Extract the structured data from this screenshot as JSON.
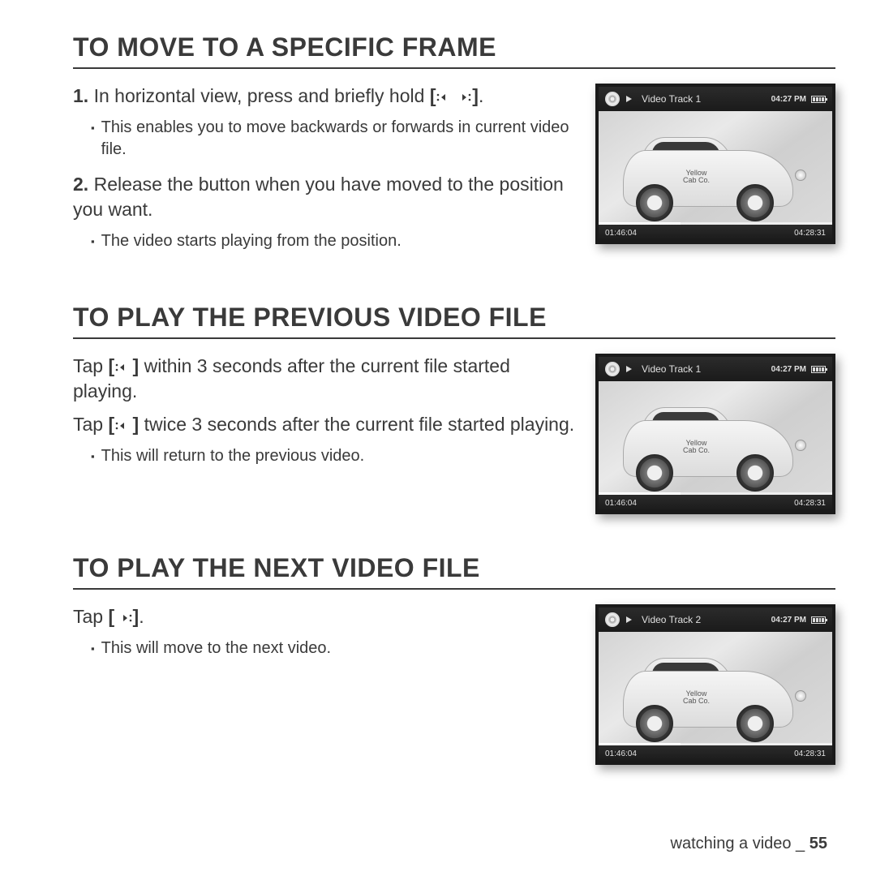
{
  "sections": [
    {
      "heading": "TO MOVE TO A SPECIFIC FRAME",
      "steps": [
        {
          "num": "1.",
          "text_before": "In horizontal view, press and briefly hold ",
          "buttons": "lr",
          "text_after": "."
        },
        {
          "sub": "This enables you to move backwards or forwards in current video file."
        },
        {
          "num": "2.",
          "text_before": "Release the button when you have moved to the position you want.",
          "buttons": "",
          "text_after": ""
        },
        {
          "sub": "The video starts playing from the position."
        }
      ],
      "video": {
        "title": "Video Track 1",
        "clock": "04:27 PM",
        "pos": "01:46:04",
        "dur": "04:28:31"
      }
    },
    {
      "heading": "TO PLAY THE PREVIOUS VIDEO FILE",
      "steps": [
        {
          "text_before": "Tap ",
          "buttons": "l",
          "text_after": " within 3 seconds after the current file started playing."
        },
        {
          "text_before": "Tap ",
          "buttons": "l",
          "text_after": " twice 3 seconds after the current file started playing."
        },
        {
          "sub": "This will return to the previous video."
        }
      ],
      "video": {
        "title": "Video Track 1",
        "clock": "04:27 PM",
        "pos": "01:46:04",
        "dur": "04:28:31"
      }
    },
    {
      "heading": "TO PLAY THE NEXT VIDEO FILE",
      "steps": [
        {
          "text_before": "Tap ",
          "buttons": "r",
          "text_after": "."
        },
        {
          "sub": "This will move to the next video."
        }
      ],
      "video": {
        "title": "Video Track 2",
        "clock": "04:27 PM",
        "pos": "01:46:04",
        "dur": "04:28:31"
      }
    }
  ],
  "footer": {
    "label": "watching a video _ ",
    "page": "55"
  },
  "car_label": "Yellow\nCab Co."
}
